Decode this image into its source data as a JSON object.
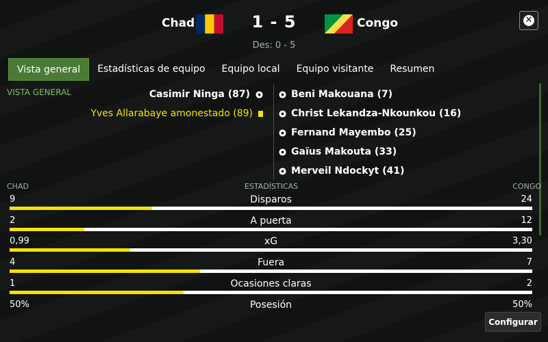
{
  "match": {
    "home_team": "Chad",
    "away_team": "Congo",
    "score": "1 - 5",
    "halftime": "Des: 0 - 5",
    "home_flag_colors": [
      "#002664",
      "#FECB00",
      "#C60C30"
    ],
    "away_flag_colors": [
      "#009543",
      "#FBDE4A",
      "#DC241F"
    ]
  },
  "tabs": [
    {
      "label": "Vista general",
      "active": true
    },
    {
      "label": "Estadísticas de equipo",
      "active": false
    },
    {
      "label": "Equipo local",
      "active": false
    },
    {
      "label": "Equipo visitante",
      "active": false
    },
    {
      "label": "Resumen",
      "active": false
    }
  ],
  "section_label": "VISTA GENERAL",
  "events": {
    "home": [
      {
        "text": "Casimir Ninga (87)",
        "type": "goal"
      },
      {
        "text": "Yves Allarabaye amonestado (89)",
        "type": "yellow-card"
      }
    ],
    "away": [
      {
        "text": "Beni Makouana (7)",
        "type": "goal"
      },
      {
        "text": "Christ Lekandza-Nkounkou (16)",
        "type": "goal"
      },
      {
        "text": "Fernand Mayembo (25)",
        "type": "goal"
      },
      {
        "text": "Gaïus Makouta (33)",
        "type": "goal"
      },
      {
        "text": "Merveil Ndockyt (41)",
        "type": "goal"
      }
    ]
  },
  "stats_header": {
    "home": "CHAD",
    "title": "ESTADÍSTICAS",
    "away": "CONGO"
  },
  "stats": [
    {
      "name": "Disparos",
      "home": "9",
      "away": "24",
      "home_share": 0.273
    },
    {
      "name": "A puerta",
      "home": "2",
      "away": "12",
      "home_share": 0.143
    },
    {
      "name": "xG",
      "home": "0,99",
      "away": "3,30",
      "home_share": null
    },
    {
      "name": "Fuera",
      "home": "4",
      "away": "7",
      "home_share": 0.364
    },
    {
      "name": "Ocasiones claras",
      "home": "1",
      "away": "2",
      "home_share": 0.333
    },
    {
      "name": "Posesión",
      "home": "50%",
      "away": "50%",
      "home_share": null
    }
  ],
  "colors": {
    "accent": "#f3e400",
    "tab_active": "#4a7a35",
    "section": "#7fc15a"
  },
  "buttons": {
    "configure": "Configurar",
    "close_icon": "close-icon"
  }
}
